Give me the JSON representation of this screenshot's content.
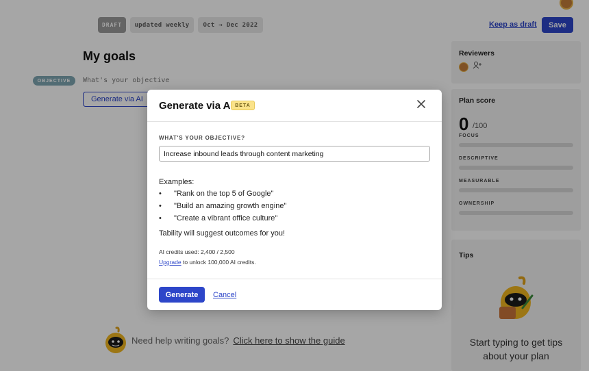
{
  "topbar": {
    "draft_badge": "DRAFT",
    "frequency": "updated weekly",
    "period": "Oct → Dec 2022",
    "keep_draft": "Keep as draft",
    "save": "Save"
  },
  "main": {
    "title": "My goals",
    "objective_badge": "OBJECTIVE",
    "objective_placeholder": "What's your objective",
    "generate_ai_button": "Generate via AI",
    "help_text": "Need help writing goals?",
    "help_link": "Click here to show the guide"
  },
  "sidebar": {
    "reviewers_heading": "Reviewers",
    "add_reviewer_icon": "＋",
    "plan_score_heading": "Plan score",
    "score": "0",
    "score_max": "/100",
    "metrics": [
      {
        "label": "FOCUS",
        "value": 0
      },
      {
        "label": "DESCRIPTIVE",
        "value": 0
      },
      {
        "label": "MEASURABLE",
        "value": 0
      },
      {
        "label": "OWNERSHIP",
        "value": 0
      }
    ],
    "tips_heading": "Tips",
    "tips_text": "Start typing to get tips about your plan"
  },
  "modal": {
    "title": "Generate via AI",
    "beta_badge": "BETA",
    "close_icon": "✕",
    "field_label": "WHAT'S YOUR OBJECTIVE?",
    "input_value": "Increase inbound leads through content marketing",
    "examples_heading": "Examples:",
    "examples": [
      "\"Rank on the top 5 of Google\"",
      "\"Build an amazing growth engine\"",
      "\"Create a vibrant office culture\""
    ],
    "suggest_text": "Tability will suggest outcomes for you!",
    "credits_text": "AI credits used: 2,400 / 2,500",
    "upgrade_link": "Upgrade",
    "upgrade_rest": " to unlock 100,000 AI credits.",
    "generate_button": "Generate",
    "cancel_link": "Cancel"
  },
  "colors": {
    "accent": "#2d46c9",
    "overlay": "rgba(0,0,0,0.35)",
    "beta_bg": "#fbe38a"
  }
}
